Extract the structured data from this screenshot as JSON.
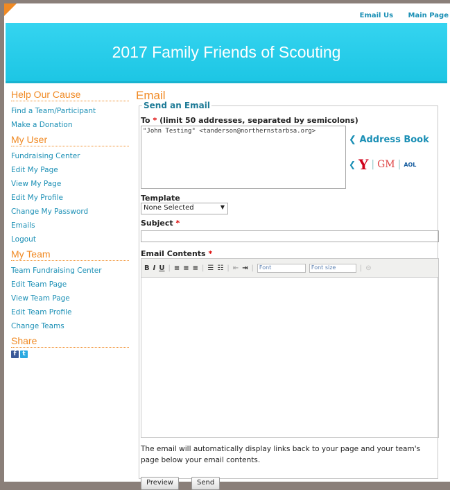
{
  "header": {
    "links": [
      "Email Us",
      "Main Page"
    ],
    "title": "2017 Family Friends of Scouting"
  },
  "sidebar": {
    "sections": [
      {
        "heading": "Help Our Cause",
        "items": [
          "Find a Team/Participant",
          "Make a Donation"
        ]
      },
      {
        "heading": "My User",
        "items": [
          "Fundraising Center",
          "Edit My Page",
          "View My Page",
          "Edit My Profile",
          "Change My Password",
          "Emails",
          "Logout"
        ]
      },
      {
        "heading": "My Team",
        "items": [
          "Team Fundraising Center",
          "Edit Team Page",
          "View Team Page",
          "Edit Team Profile",
          "Change Teams"
        ]
      },
      {
        "heading": "Share",
        "items": []
      }
    ]
  },
  "main": {
    "title": "Email",
    "legend": "Send an Email",
    "to_label": "To",
    "to_required": "*",
    "to_hint": "(limit 50 addresses, separated by semicolons)",
    "to_value": "\"John Testing\" <tanderson@northernstarbsa.org>",
    "address_book": "Address Book",
    "providers": {
      "gmail": "GM",
      "aol": "AOL"
    },
    "template_label": "Template",
    "template_value": "None Selected",
    "subject_label": "Subject",
    "subject_required": "*",
    "contents_label": "Email Contents",
    "contents_required": "*",
    "toolbar": {
      "bold": "B",
      "italic": "I",
      "underline": "U",
      "font": "Font",
      "font_size": "Font size"
    },
    "note": "The email will automatically display links back to your page and your team's page below your email contents.",
    "preview_button": "Preview",
    "send_button": "Send"
  },
  "colors": {
    "accent": "#f08a24",
    "banner": "#27cde9",
    "link": "#1a8fb5"
  }
}
